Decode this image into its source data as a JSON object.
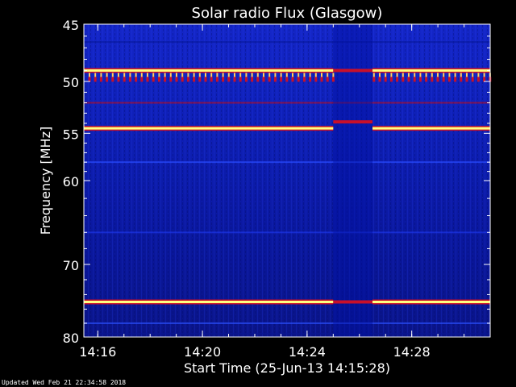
{
  "chart_data": {
    "type": "heatmap",
    "title": "Solar radio Flux (Glasgow)",
    "xlabel": "Start Time (25-Jun-13 14:15:28)",
    "ylabel": "Frequency [MHz]",
    "x_ticks": [
      "14:16",
      "14:20",
      "14:24",
      "14:28"
    ],
    "y_ticks": [
      45,
      50,
      55,
      60,
      70,
      80
    ],
    "ylim_mhz": [
      45,
      80
    ],
    "y_scale": "log",
    "colormap": "blue-red-yellow",
    "colors": {
      "background": "#000000",
      "low": "#0c1fbf",
      "mid": "#c8102a",
      "high": "#ffff80"
    },
    "bright_bands_mhz": [
      49,
      54.5,
      75
    ],
    "gap_interval": [
      "14:25",
      "14:26.5"
    ]
  },
  "footer": {
    "updated": "Updated Wed Feb 21 22:34:58 2018"
  }
}
